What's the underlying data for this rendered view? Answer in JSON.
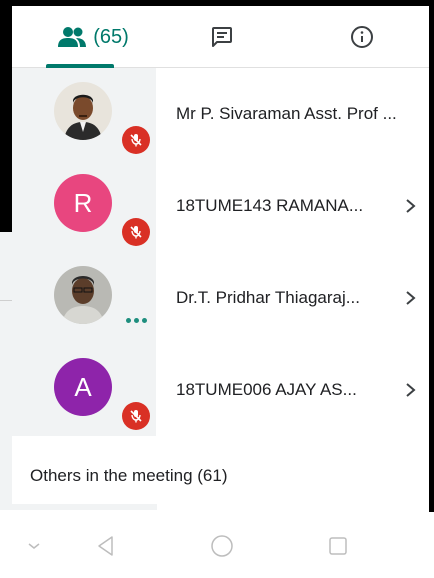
{
  "tabs": {
    "people_count": "(65)",
    "people_icon": "people-icon",
    "chat_icon": "chat-icon",
    "info_icon": "info-icon",
    "accent_color": "#00796b"
  },
  "participants": [
    {
      "name": "Mr P. Sivaraman Asst. Prof ...",
      "avatar": "photo",
      "status_icon": "mic-off-icon"
    },
    {
      "name": "18TUME143 RAMANA...",
      "avatar_letter": "R",
      "avatar_color": "#e8467f",
      "status_icon": "mic-off-icon"
    },
    {
      "name": "Dr.T. Pridhar Thiagaraj...",
      "avatar": "photo",
      "status_icon": "more-dots-icon"
    },
    {
      "name": "18TUME006 AJAY AS...",
      "avatar_letter": "A",
      "avatar_color": "#8e24aa",
      "status_icon": "mic-off-icon"
    }
  ],
  "others_label": "Others in the meeting (61)",
  "navbar": {
    "icons": [
      "collapse-chevron-icon",
      "back-icon",
      "home-icon",
      "recents-icon"
    ]
  },
  "colors": {
    "mic_off": "#d93025",
    "avatar_bg": "#f1f3f4"
  }
}
